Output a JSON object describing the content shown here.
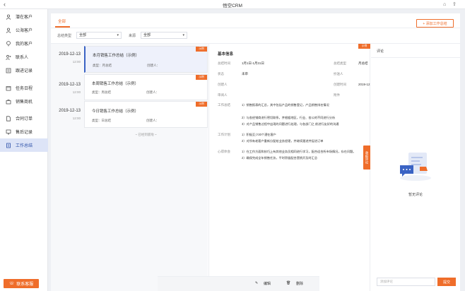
{
  "window": {
    "title": "悟空CRM"
  },
  "sidebar": {
    "items": [
      {
        "label": "潜在客户",
        "icon": "potential-customer-icon"
      },
      {
        "label": "公海客户",
        "icon": "public-customer-icon"
      },
      {
        "label": "我的客户",
        "icon": "my-customer-icon"
      },
      {
        "label": "联系人",
        "icon": "contact-icon"
      },
      {
        "label": "跟进记录",
        "icon": "followup-icon"
      },
      {
        "label": "任务日程",
        "icon": "task-icon"
      },
      {
        "label": "销售商机",
        "icon": "opportunity-icon"
      },
      {
        "label": "合同订单",
        "icon": "contract-icon"
      },
      {
        "label": "售后记录",
        "icon": "aftersale-icon"
      },
      {
        "label": "工作总结",
        "icon": "summary-icon",
        "active": true
      }
    ],
    "service_button": "联系客服"
  },
  "tabs": {
    "all": "全部"
  },
  "toolbar": {
    "add_button": "+ 添加工作总结"
  },
  "filters": {
    "type_label": "总结类型",
    "type_value": "全部",
    "source_label": "来源",
    "source_value": "全部"
  },
  "list": {
    "items": [
      {
        "date": "2019-12-13",
        "time": "12:00",
        "title": "本月销售工作总结（示例）",
        "type": "类型：月总结",
        "creator": "创建人：",
        "tag": "示例"
      },
      {
        "date": "2019-12-13",
        "time": "12:00",
        "title": "本周销售工作总结（示例）",
        "type": "类型：周总结",
        "creator": "创建人：",
        "tag": "示例"
      },
      {
        "date": "2019-12-13",
        "time": "12:00",
        "title": "今日销售工作总结（示例）",
        "type": "类型：日总结",
        "creator": "创建人：",
        "tag": "示例"
      }
    ],
    "end_text": "~ 已经到底啦 ~"
  },
  "detail": {
    "section_title": "基本信息",
    "tag": "示例",
    "fields": {
      "period_label": "总结时间",
      "period_value": "1月1日-1月31日",
      "type_label": "总结类型",
      "type_value": "月总结",
      "status_label": "状态",
      "status_value": "未审",
      "cc_label": "抄送人",
      "creator_label": "创建人",
      "created_label": "创建时间",
      "created_value": "2019-12",
      "reviewer_label": "审阅人",
      "attachment_label": "附件"
    },
    "summary_label": "工作总结",
    "summary_lines": [
      "1）销售报表的汇总，其中包括产品的销售登记，产品销售排名情况",
      "2）与各经销商进行密切联系，并根据地区，行业、各公的不同进行分析",
      "3）对产品销售过程中出现的问题进行处理，与各部门之 前进行友好的沟通"
    ],
    "plan_label": "工作计划",
    "plan_lines": [
      "1）积极至少30个潜在客户",
      "2）对所有老客户重新分配给业务经理，并继续跟进并促进订单"
    ],
    "reflection_label": "心得体会",
    "reflection_lines": [
      "1）在工作方面和技巧上有其他业务员相同进行学习，配合适合所市场情况，存在问题。",
      "2）确保完成全年销售任务，平时积极配合营销开及时汇总"
    ],
    "side_tab": "收起评论",
    "footer": {
      "edit": "编辑",
      "delete": "删除"
    }
  },
  "comments": {
    "header": "评论",
    "empty_text": "暂无评论",
    "input_placeholder": "添加评论",
    "send_button": "提交"
  },
  "colors": {
    "accent": "#ef6d2a",
    "nav_active": "#2b4fa8"
  }
}
